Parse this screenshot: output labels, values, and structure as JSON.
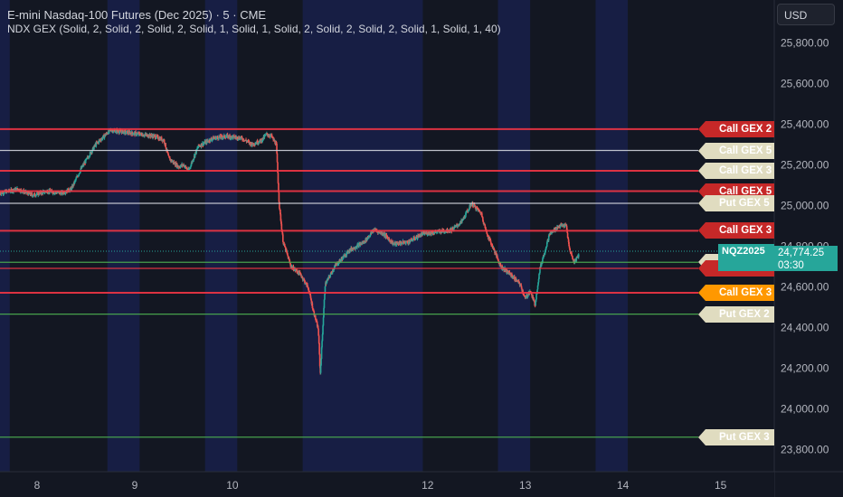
{
  "header": {
    "title": "E-mini Nasdaq-100 Futures (Dec 2025) · 5 · CME",
    "indicator": "NDX GEX (Solid, 2, Solid, 2, Solid, 2, Solid, 1, Solid, 1, Solid, 2, Solid, 2, Solid, 2, Solid, 1, Solid, 1, 40)"
  },
  "currency_button": "USD",
  "last_price": {
    "symbol": "NQZ2025",
    "value": "24,774.25",
    "countdown": "03:30",
    "color": "#26a69a"
  },
  "colors": {
    "background": "#131722",
    "session_band": "#1a2250",
    "up_candle": "#26a69a",
    "down_candle": "#ef5350",
    "call_line": "#f23645",
    "put_line": "#4caf50",
    "neutral_line": "#d1d4dc"
  },
  "gex_levels": [
    {
      "label": "Call GEX 2",
      "price": 25375,
      "kind": "call",
      "tag_bg": "#c62828",
      "tag_fg": "#ffffff",
      "line": "#f23645"
    },
    {
      "label": "Call GEX 5",
      "price": 25270,
      "kind": "call",
      "tag_bg": "#e0dcc0",
      "tag_fg": "#ffffff",
      "line": "#d1d4dc"
    },
    {
      "label": "Call GEX 3",
      "price": 25170,
      "kind": "call",
      "tag_bg": "#e0dcc0",
      "tag_fg": "#ffffff",
      "line": "#f23645"
    },
    {
      "label": "Call GEX 5",
      "price": 25070,
      "kind": "call",
      "tag_bg": "#c62828",
      "tag_fg": "#ffffff",
      "line": "#f23645"
    },
    {
      "label": "Put GEX 5",
      "price": 25010,
      "kind": "put",
      "tag_bg": "#e0dcc0",
      "tag_fg": "#ffffff",
      "line": "#d1d4dc"
    },
    {
      "label": "Call GEX 3",
      "price": 24875,
      "kind": "call",
      "tag_bg": "#c62828",
      "tag_fg": "#ffffff",
      "line": "#f23645"
    },
    {
      "label": "Put GEX 4",
      "price": 24720,
      "kind": "put",
      "tag_bg": "#e0dcc0",
      "tag_fg": "#ffffff",
      "line": "#4caf50"
    },
    {
      "label": "Put GEX 5",
      "price": 24690,
      "kind": "put",
      "tag_bg": "#c62828",
      "tag_fg": "#ffffff",
      "line": "#f23645"
    },
    {
      "label": "Call GEX 3",
      "price": 24570,
      "kind": "call",
      "tag_bg": "#ff9800",
      "tag_fg": "#ffffff",
      "line": "#f23645"
    },
    {
      "label": "Put GEX 2",
      "price": 24465,
      "kind": "put",
      "tag_bg": "#e0dcc0",
      "tag_fg": "#ffffff",
      "line": "#4caf50"
    },
    {
      "label": "Put GEX 3",
      "price": 23860,
      "kind": "put",
      "tag_bg": "#e0dcc0",
      "tag_fg": "#ffffff",
      "line": "#4caf50"
    }
  ],
  "chart_data": {
    "type": "candlestick",
    "y_axis_labels": [
      "25,800.00",
      "25,600.00",
      "25,400.00",
      "25,200.00",
      "25,000.00",
      "24,800.00",
      "24,600.00",
      "24,400.00",
      "24,200.00",
      "24,000.00",
      "23,800.00"
    ],
    "y_axis_values": [
      25800,
      25600,
      25400,
      25200,
      25000,
      24800,
      24600,
      24400,
      24200,
      24000,
      23800
    ],
    "ylim": [
      23690,
      26010
    ],
    "x_axis_labels": [
      "8",
      "9",
      "10",
      "12",
      "13",
      "14",
      "15"
    ],
    "x_axis_days": [
      8,
      9,
      10,
      12,
      13,
      14,
      15
    ],
    "xlim": [
      7.62,
      15.55
    ],
    "price_path": [
      [
        7.62,
        25060
      ],
      [
        7.8,
        25080
      ],
      [
        7.95,
        25050
      ],
      [
        8.1,
        25070
      ],
      [
        8.25,
        25060
      ],
      [
        8.35,
        25080
      ],
      [
        8.45,
        25180
      ],
      [
        8.6,
        25300
      ],
      [
        8.75,
        25370
      ],
      [
        8.9,
        25360
      ],
      [
        9.05,
        25350
      ],
      [
        9.2,
        25340
      ],
      [
        9.3,
        25320
      ],
      [
        9.35,
        25230
      ],
      [
        9.45,
        25190
      ],
      [
        9.5,
        25200
      ],
      [
        9.55,
        25170
      ],
      [
        9.65,
        25290
      ],
      [
        9.8,
        25330
      ],
      [
        9.95,
        25340
      ],
      [
        10.1,
        25330
      ],
      [
        10.2,
        25300
      ],
      [
        10.3,
        25320
      ],
      [
        10.35,
        25350
      ],
      [
        10.4,
        25340
      ],
      [
        10.45,
        25300
      ],
      [
        10.48,
        25000
      ],
      [
        10.52,
        24820
      ],
      [
        10.6,
        24700
      ],
      [
        10.7,
        24660
      ],
      [
        10.78,
        24590
      ],
      [
        10.83,
        24480
      ],
      [
        10.88,
        24390
      ],
      [
        10.9,
        24170
      ],
      [
        10.95,
        24610
      ],
      [
        11.05,
        24700
      ],
      [
        11.2,
        24780
      ],
      [
        11.35,
        24820
      ],
      [
        11.45,
        24880
      ],
      [
        11.55,
        24860
      ],
      [
        11.65,
        24810
      ],
      [
        11.8,
        24820
      ],
      [
        11.95,
        24860
      ],
      [
        12.1,
        24870
      ],
      [
        12.25,
        24880
      ],
      [
        12.35,
        24920
      ],
      [
        12.45,
        25010
      ],
      [
        12.55,
        24960
      ],
      [
        12.6,
        24870
      ],
      [
        12.68,
        24780
      ],
      [
        12.75,
        24700
      ],
      [
        12.85,
        24660
      ],
      [
        12.95,
        24610
      ],
      [
        13.0,
        24540
      ],
      [
        13.05,
        24580
      ],
      [
        13.1,
        24510
      ],
      [
        13.15,
        24690
      ],
      [
        13.25,
        24860
      ],
      [
        13.35,
        24900
      ],
      [
        13.42,
        24900
      ],
      [
        13.45,
        24790
      ],
      [
        13.5,
        24720
      ],
      [
        13.55,
        24760
      ]
    ]
  }
}
